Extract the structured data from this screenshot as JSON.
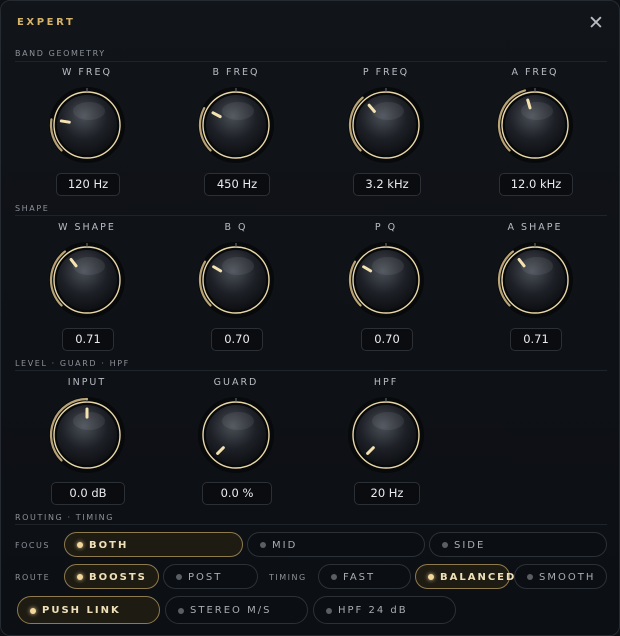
{
  "header": {
    "title": "EXPERT",
    "close_icon": "close-icon"
  },
  "sections": {
    "band_geometry": "BAND GEOMETRY",
    "shape": "SHAPE",
    "level": "LEVEL · GUARD · HPF",
    "routing": "ROUTING · TIMING"
  },
  "band_geometry": [
    {
      "label": "W FREQ",
      "value": "120 Hz",
      "level": 0.2
    },
    {
      "label": "B FREQ",
      "value": "450 Hz",
      "level": 0.27
    },
    {
      "label": "P FREQ",
      "value": "3.2 kHz",
      "level": 0.35
    },
    {
      "label": "A FREQ",
      "value": "12.0 kHz",
      "level": 0.44
    }
  ],
  "shape": [
    {
      "label": "W SHAPE",
      "value": "0.71",
      "level": 0.36
    },
    {
      "label": "B Q",
      "value": "0.70",
      "level": 0.28
    },
    {
      "label": "P Q",
      "value": "0.70",
      "level": 0.28
    },
    {
      "label": "A SHAPE",
      "value": "0.71",
      "level": 0.36
    }
  ],
  "level": [
    {
      "label": "INPUT",
      "value": "0.0 dB",
      "level": 0.5
    },
    {
      "label": "GUARD",
      "value": "0.0 %",
      "level": 0.0
    },
    {
      "label": "HPF",
      "value": "20 Hz",
      "level": 0.0
    }
  ],
  "routing": {
    "focus_label": "FOCUS",
    "focus_options": [
      {
        "label": "BOTH",
        "active": true
      },
      {
        "label": "MID",
        "active": false
      },
      {
        "label": "SIDE",
        "active": false
      }
    ],
    "route_label": "ROUTE",
    "route_options": [
      {
        "label": "BOOSTS",
        "active": true
      },
      {
        "label": "POST",
        "active": false
      }
    ],
    "timing_label": "TIMING",
    "timing_options": [
      {
        "label": "FAST",
        "active": false
      },
      {
        "label": "BALANCED",
        "active": true
      },
      {
        "label": "SMOOTH",
        "active": false
      }
    ],
    "toggles": [
      {
        "label": "PUSH LINK",
        "active": true
      },
      {
        "label": "STEREO M/S",
        "active": false
      },
      {
        "label": "HPF 24 dB",
        "active": false
      }
    ]
  },
  "colors": {
    "accent": "#d6b46a",
    "ring": "#e9d7a8",
    "background": "#0d1014"
  }
}
